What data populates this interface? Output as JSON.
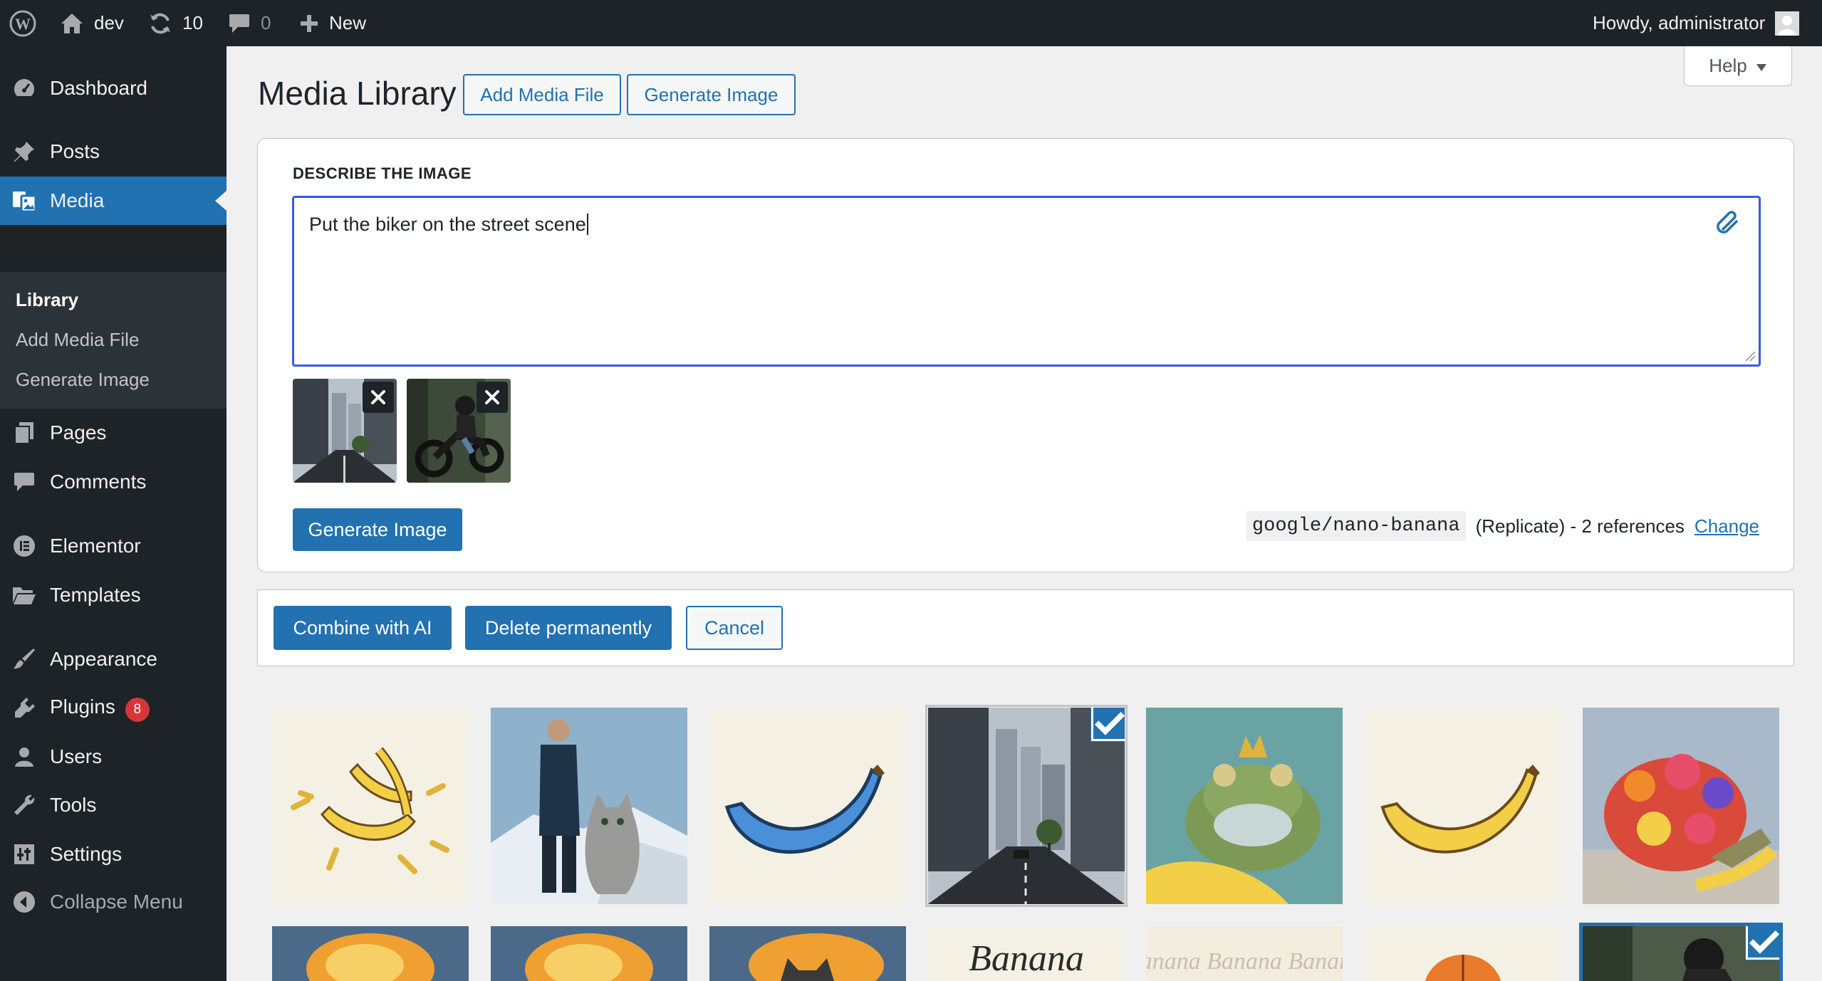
{
  "admin_bar": {
    "site_name": "dev",
    "updates_count": "10",
    "comments_count": "0",
    "new_label": "New",
    "howdy": "Howdy, administrator",
    "icons": [
      "wordpress-logo-icon",
      "home-icon",
      "updates-icon",
      "comment-icon",
      "plus-icon",
      "avatar"
    ]
  },
  "sidebar": {
    "items": [
      {
        "label": "Dashboard",
        "icon": "dashboard-icon"
      },
      {
        "label": "Posts",
        "icon": "pin-icon"
      },
      {
        "label": "Media",
        "icon": "media-icon",
        "current": true
      },
      {
        "label": "Pages",
        "icon": "pages-icon"
      },
      {
        "label": "Comments",
        "icon": "comment-icon"
      },
      {
        "label": "Elementor",
        "icon": "elementor-icon"
      },
      {
        "label": "Templates",
        "icon": "folder-icon"
      },
      {
        "label": "Appearance",
        "icon": "brush-icon"
      },
      {
        "label": "Plugins",
        "icon": "plugin-icon",
        "badge": "8"
      },
      {
        "label": "Users",
        "icon": "user-icon"
      },
      {
        "label": "Tools",
        "icon": "wrench-icon"
      },
      {
        "label": "Settings",
        "icon": "settings-icon"
      },
      {
        "label": "Collapse Menu",
        "icon": "collapse-icon"
      }
    ],
    "submenu": [
      {
        "label": "Library",
        "current": true
      },
      {
        "label": "Add Media File"
      },
      {
        "label": "Generate Image"
      }
    ]
  },
  "header": {
    "title": "Media Library",
    "add_media_label": "Add Media File",
    "generate_label": "Generate Image",
    "help_label": "Help"
  },
  "generator": {
    "describe_label": "DESCRIBE THE IMAGE",
    "prompt_value": "Put the biker on the street scene",
    "generate_button": "Generate Image",
    "model": "google/nano-banana",
    "model_suffix": "(Replicate) - 2 references",
    "change_link": "Change",
    "references": [
      "street-scene",
      "biker"
    ]
  },
  "bulk_actions": {
    "combine": "Combine with AI",
    "delete": "Delete permanently",
    "cancel": "Cancel"
  },
  "media_grid": {
    "row1": [
      {
        "name": "bananas-splash",
        "selected": false
      },
      {
        "name": "man-with-cat-snow",
        "selected": false
      },
      {
        "name": "blue-banana",
        "selected": false
      },
      {
        "name": "city-street",
        "selected": true
      },
      {
        "name": "frog-king",
        "selected": false
      },
      {
        "name": "banana",
        "selected": false
      },
      {
        "name": "flower-turtle",
        "selected": false
      }
    ],
    "row2": [
      {
        "name": "explosion-1",
        "selected": false
      },
      {
        "name": "explosion-2",
        "selected": false
      },
      {
        "name": "explosion-cat",
        "selected": false
      },
      {
        "name": "banana-script",
        "selected": false,
        "text": "Banana"
      },
      {
        "name": "banana-pattern",
        "selected": false,
        "text": "Banana Banana Banana"
      },
      {
        "name": "orange-fruit",
        "selected": false
      },
      {
        "name": "biker",
        "selected": true
      }
    ]
  },
  "colors": {
    "admin_dark": "#1d2327",
    "accent": "#2271b1",
    "badge_red": "#d63638",
    "focus_blue": "#3858e9"
  }
}
